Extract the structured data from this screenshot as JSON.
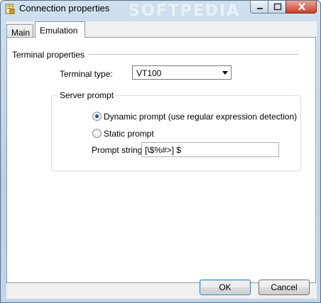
{
  "window": {
    "title": "Connection properties",
    "watermark": "SOFTPEDIA",
    "controls": {
      "minimize": "minimize",
      "maximize": "maximize",
      "close": "close"
    }
  },
  "tabs": [
    {
      "label": "Main",
      "active": false
    },
    {
      "label": "Emulation",
      "active": true
    }
  ],
  "terminal_properties": {
    "section_title": "Terminal properties",
    "terminal_type_label": "Terminal type:",
    "terminal_type_value": "VT100"
  },
  "server_prompt": {
    "group_title": "Server prompt",
    "options": [
      {
        "label": "Dynamic prompt (use regular expression detection)",
        "selected": true
      },
      {
        "label": "Static prompt",
        "selected": false
      }
    ],
    "prompt_string_label": "Prompt string:",
    "prompt_string_value": "[\\$%#>] $"
  },
  "buttons": {
    "ok": "OK",
    "cancel": "Cancel"
  },
  "colors": {
    "accent": "#3c7fb1",
    "window_frame": "#b9d0e6",
    "close_red": "#c8402c"
  }
}
